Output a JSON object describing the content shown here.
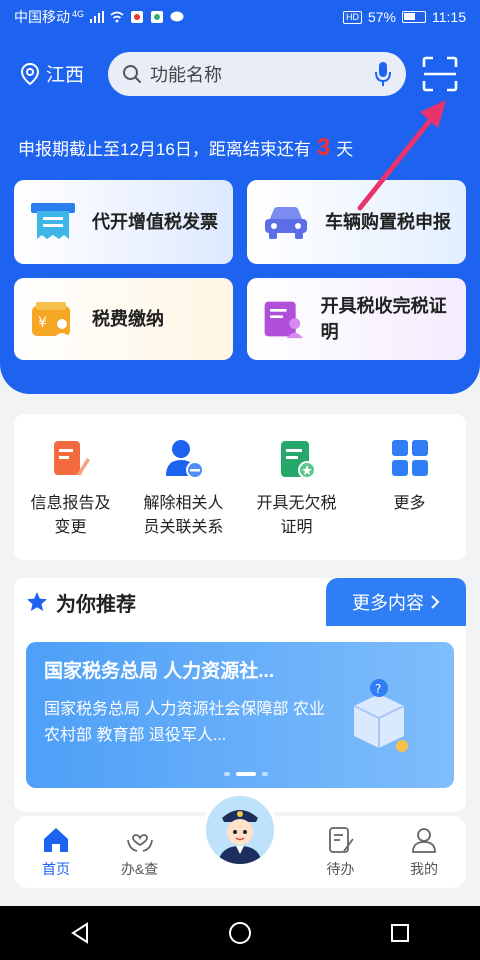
{
  "status_bar": {
    "carrier": "中国移动",
    "network": "4G",
    "battery": "57%",
    "time": "11:15",
    "hd": "HD"
  },
  "header": {
    "location": "江西",
    "search_placeholder": "功能名称"
  },
  "deadline": {
    "prefix": "申报期截止至12月16日，距离结束还有",
    "days": "3",
    "suffix": "天"
  },
  "services": [
    {
      "label": "代开增值税发票",
      "icon": "invoice-icon"
    },
    {
      "label": "车辆购置税申报",
      "icon": "car-icon"
    },
    {
      "label": "税费缴纳",
      "icon": "wallet-icon"
    },
    {
      "label": "开具税收完税证明",
      "icon": "certificate-icon"
    }
  ],
  "quick": [
    {
      "label": "信息报告及变更",
      "icon": "edit-report-icon",
      "color": "#f26a3d"
    },
    {
      "label": "解除相关人员关联关系",
      "icon": "person-remove-icon",
      "color": "#1e63f0"
    },
    {
      "label": "开具无欠税证明",
      "icon": "certificate-star-icon",
      "color": "#27a86b"
    },
    {
      "label": "更多",
      "icon": "grid-icon",
      "color": "#2f7ef5"
    }
  ],
  "recommend": {
    "title": "为你推荐",
    "more": "更多内容",
    "banner_title": "国家税务总局 人力资源社...",
    "banner_desc": "国家税务总局 人力资源社会保障部 农业农村部 教育部 退役军人..."
  },
  "tabs": [
    {
      "label": "首页",
      "icon": "home-icon"
    },
    {
      "label": "办&查",
      "icon": "heart-hands-icon"
    },
    {
      "label": "待办",
      "icon": "todo-icon"
    },
    {
      "label": "我的",
      "icon": "user-icon"
    }
  ],
  "colors": {
    "primary": "#1e63f0",
    "accent_red": "#ff2d2d",
    "annotation_arrow": "#e8336d"
  }
}
